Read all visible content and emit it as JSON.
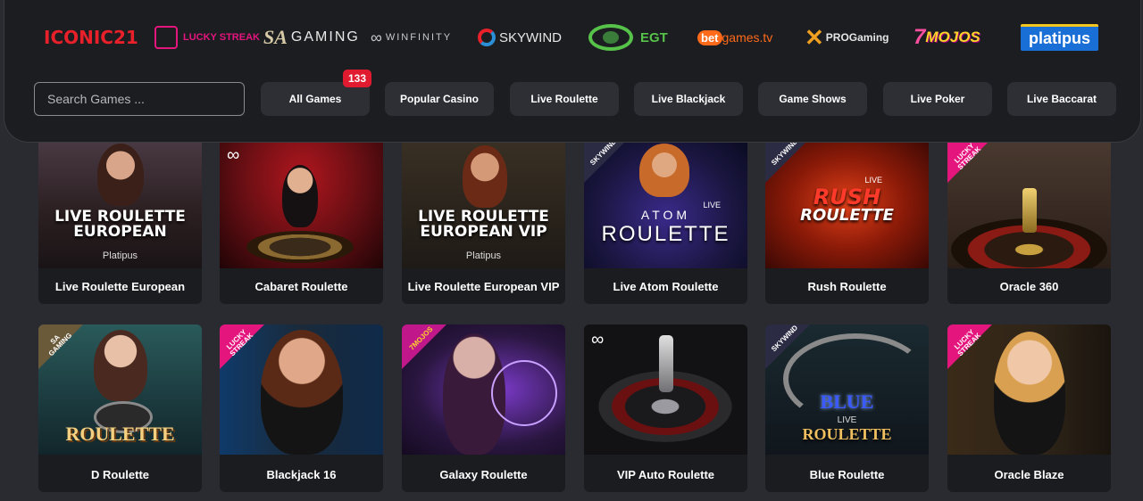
{
  "providers": [
    {
      "name": "ICONIC21",
      "color": "#e8202a"
    },
    {
      "name": "LUCKY STREAK",
      "color": "#e5157e"
    },
    {
      "name": "GAMING",
      "prefix": "SA",
      "color": "#d6c9a6"
    },
    {
      "name": "WINFINITY",
      "color": "#c8c8cc"
    },
    {
      "name": "SKYWIND",
      "color": "#e6e6e6"
    },
    {
      "name": "EGT",
      "color": "#57c24a"
    },
    {
      "name": "games.tv",
      "prefix": "bet",
      "color": "#ff6a1a"
    },
    {
      "name": "PROGaming",
      "color": "#f0a020"
    },
    {
      "name": "MOJOS",
      "prefix": "7",
      "color": "#ff4fa0"
    },
    {
      "name": "platipus",
      "color": "#1a6fd6"
    }
  ],
  "search": {
    "placeholder": "Search Games ..."
  },
  "categories": [
    {
      "label": "All Games",
      "badge": "133"
    },
    {
      "label": "Popular Casino"
    },
    {
      "label": "Live Roulette"
    },
    {
      "label": "Live Blackjack"
    },
    {
      "label": "Game Shows"
    },
    {
      "label": "Live Poker"
    },
    {
      "label": "Live Baccarat"
    }
  ],
  "games": [
    {
      "name": "Live Roulette European",
      "thumb_title": "LIVE ROULETTE EUROPEAN",
      "thumb_sub": "Platipus",
      "bg": "#3a2a28"
    },
    {
      "name": "Cabaret Roulette",
      "thumb_title": "",
      "bg": "#6a0f14"
    },
    {
      "name": "Live Roulette European VIP",
      "thumb_title": "LIVE ROULETTE EUROPEAN VIP",
      "thumb_sub": "Platipus",
      "bg": "#2a2520"
    },
    {
      "name": "Live Atom Roulette",
      "thumb_title": "ROULETTE",
      "thumb_pre": "ATOM",
      "thumb_live": "LIVE",
      "ribbon": "SKYWIND",
      "bg": "#1a1640"
    },
    {
      "name": "Rush Roulette",
      "thumb_title": "ROULETTE",
      "thumb_pre": "RUSH",
      "thumb_live": "LIVE",
      "ribbon": "SKYWIND",
      "bg": "#6a1608"
    },
    {
      "name": "Oracle 360",
      "thumb_title": "",
      "ribbon": "LUCKY STREAK",
      "bg": "#3a2a22"
    },
    {
      "name": "D Roulette",
      "thumb_title": "ROULETTE",
      "ribbon": "SA GAMING",
      "bg": "#1b3a3e"
    },
    {
      "name": "Blackjack 16",
      "thumb_title": "",
      "ribbon": "LUCKY STREAK",
      "bg": "#0f2a4a"
    },
    {
      "name": "Galaxy Roulette",
      "thumb_title": "",
      "ribbon": "7MOJOS",
      "bg": "#2a1640"
    },
    {
      "name": "VIP Auto Roulette",
      "thumb_title": "",
      "bg": "#121214"
    },
    {
      "name": "Blue Roulette",
      "thumb_title": "ROULETTE",
      "thumb_pre": "BLUE",
      "thumb_live": "LIVE",
      "ribbon": "SKYWIND",
      "bg": "#10161c"
    },
    {
      "name": "Oracle Blaze",
      "thumb_title": "",
      "ribbon": "LUCKY STREAK",
      "bg": "#2e2418"
    }
  ]
}
